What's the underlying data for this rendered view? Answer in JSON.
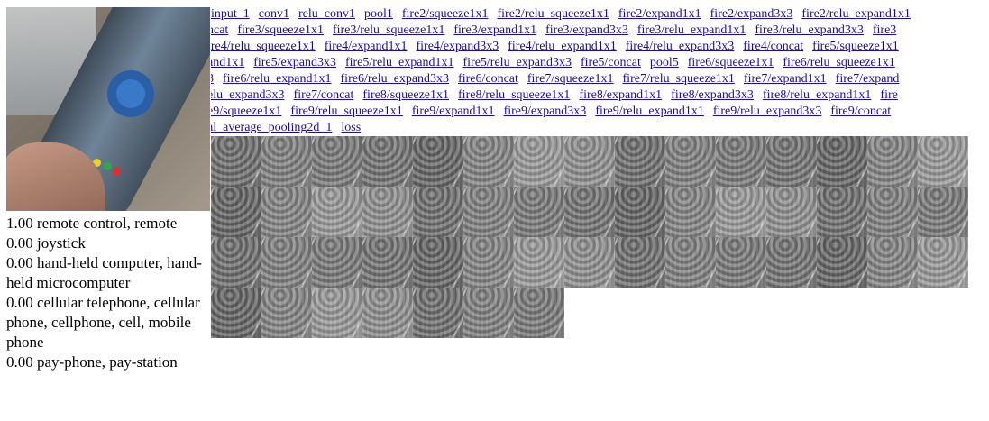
{
  "predictions": [
    "1.00 remote control, remote",
    "0.00 joystick",
    "0.00 hand-held computer, hand-held microcomputer",
    "0.00 cellular telephone, cellular phone, cellphone, cell, mobile phone",
    "0.00 pay-phone, pay-station"
  ],
  "layer_rows": [
    [
      "input_1",
      "conv1",
      "relu_conv1",
      "pool1",
      "fire2/squeeze1x1",
      "fire2/relu_squeeze1x1",
      "fire2/expand1x1",
      "fire2/expand3x3",
      "fire2/relu_expand1x1"
    ],
    [
      "ncat",
      "fire3/squeeze1x1",
      "fire3/relu_squeeze1x1",
      "fire3/expand1x1",
      "fire3/expand3x3",
      "fire3/relu_expand1x1",
      "fire3/relu_expand3x3",
      "fire3"
    ],
    [
      "ire4/relu_squeeze1x1",
      "fire4/expand1x1",
      "fire4/expand3x3",
      "fire4/relu_expand1x1",
      "fire4/relu_expand3x3",
      "fire4/concat",
      "fire5/squeeze1x1"
    ],
    [
      "and1x1",
      "fire5/expand3x3",
      "fire5/relu_expand1x1",
      "fire5/relu_expand3x3",
      "fire5/concat",
      "pool5",
      "fire6/squeeze1x1",
      "fire6/relu_squeeze1x1"
    ],
    [
      "3",
      "fire6/relu_expand1x1",
      "fire6/relu_expand3x3",
      "fire6/concat",
      "fire7/squeeze1x1",
      "fire7/relu_squeeze1x1",
      "fire7/expand1x1",
      "fire7/expand"
    ],
    [
      "elu_expand3x3",
      "fire7/concat",
      "fire8/squeeze1x1",
      "fire8/relu_squeeze1x1",
      "fire8/expand1x1",
      "fire8/expand3x3",
      "fire8/relu_expand1x1",
      "fire"
    ],
    [
      "e9/squeeze1x1",
      "fire9/relu_squeeze1x1",
      "fire9/expand1x1",
      "fire9/expand3x3",
      "fire9/relu_expand1x1",
      "fire9/relu_expand3x3",
      "fire9/concat"
    ],
    [
      "al_average_pooling2d_1",
      "loss"
    ]
  ],
  "feature_map_count": 52
}
